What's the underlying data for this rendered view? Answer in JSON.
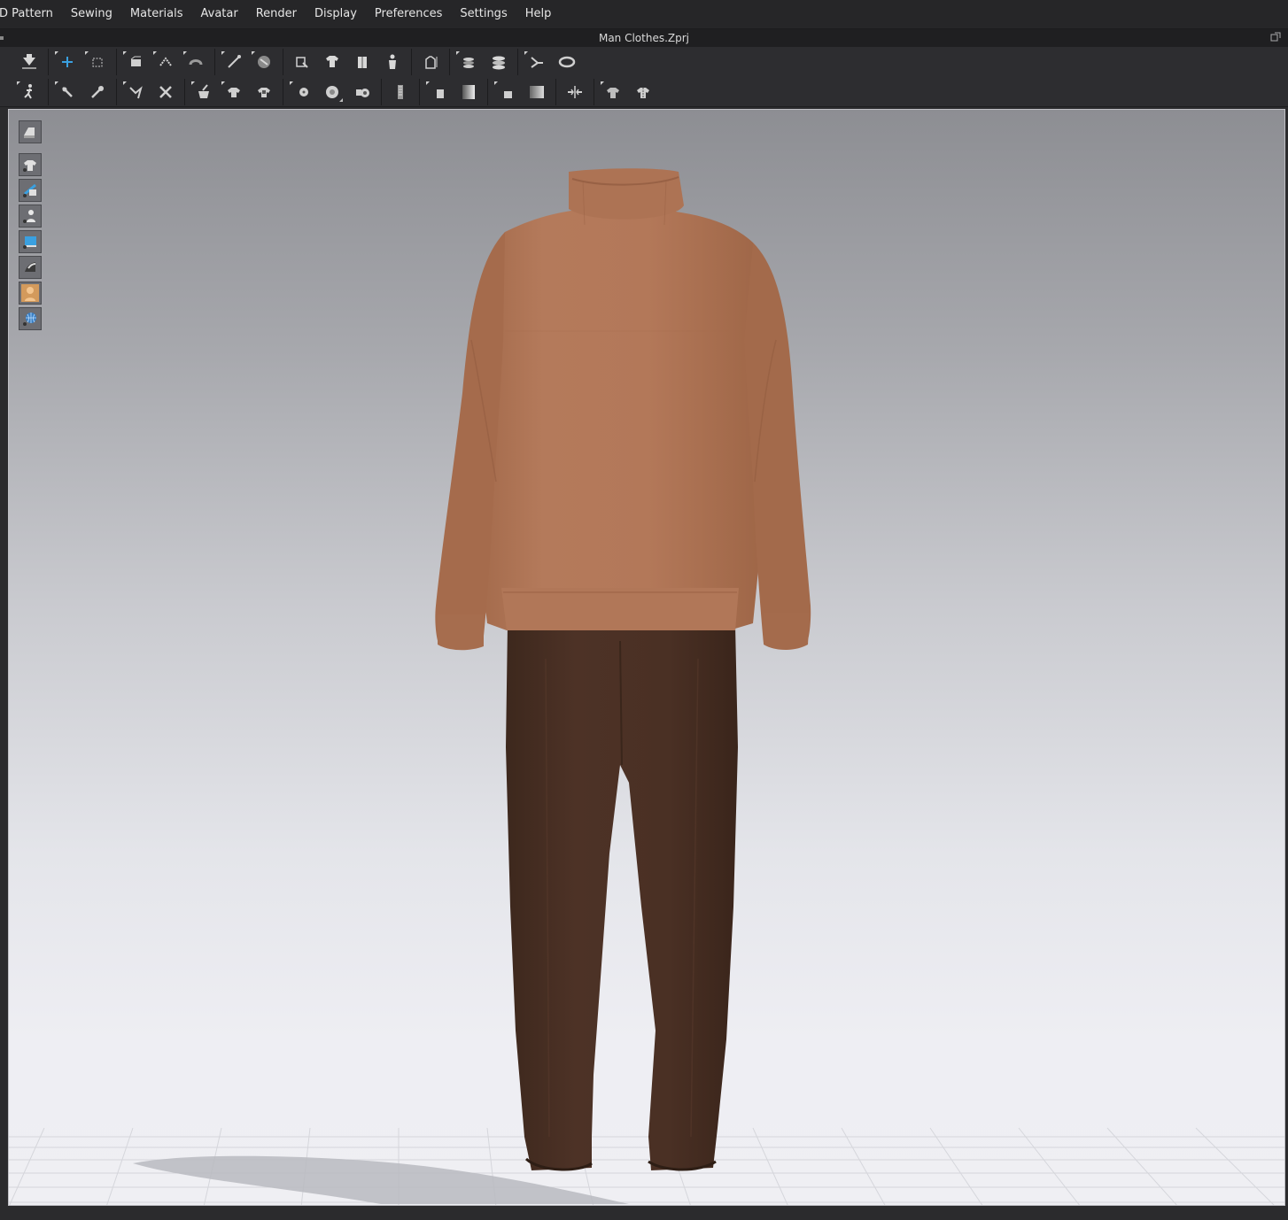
{
  "menu": {
    "items": [
      "D Pattern",
      "Sewing",
      "Materials",
      "Avatar",
      "Render",
      "Display",
      "Preferences",
      "Settings",
      "Help"
    ]
  },
  "window": {
    "title": "Man Clothes.Zprj"
  },
  "toolbar1": {
    "icons": [
      "simulation-icon",
      "select-move-icon",
      "select-box-icon",
      "fold-arrangement-icon",
      "fold-3d-icon",
      "unfold-icon",
      "draw-line-icon",
      "edit-avatar-icon",
      "tack-icon",
      "garment-fit-icon",
      "avatar-icon",
      "shirt-icon",
      "show-avatar-icon",
      "measure-icon",
      "layer-icon",
      "layer-stack-icon",
      "fold-icon",
      "tape-measure-icon"
    ]
  },
  "toolbar2": {
    "icons": [
      "pose-icon",
      "pin-icon",
      "pin-box-icon",
      "brush-icon",
      "cut-icon",
      "fabric-paint-icon",
      "trim-icon",
      "button-icon",
      "button-hole-icon",
      "snap-icon",
      "zipper-icon",
      "puckering-icon",
      "gradient-icon",
      "piping-icon",
      "fill-icon",
      "align-icon",
      "shirring-icon",
      "texture-icon"
    ]
  },
  "viewport_tools": [
    "render-mode-icon",
    "show-garment-icon",
    "show-pattern-icon",
    "show-avatar-icon",
    "show-3d-pen-icon",
    "show-shape-icon",
    "avatar-skin-icon",
    "environment-icon"
  ],
  "colors": {
    "sweater": "#b07456",
    "pants": "#4a3024",
    "accent": "#3aa0e0"
  }
}
